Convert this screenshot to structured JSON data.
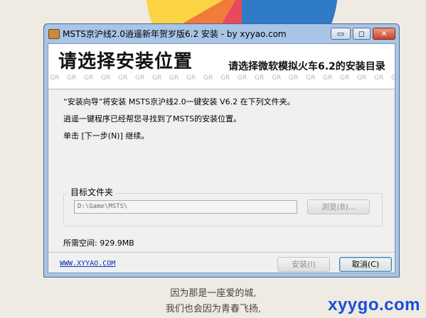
{
  "window": {
    "title": "MSTS京沪线2.0逍遥新年贺岁版6.2 安装 - by xyyao.com",
    "minimize_label": "▭",
    "maximize_label": "◻",
    "close_label": "✕"
  },
  "banner": {
    "heading": "请选择安装位置",
    "subheading": "请选择微软模拟火车6.2的安装目录",
    "watermark": "GR"
  },
  "body": {
    "line1": "“安装向导”将安装 MSTS京沪线2.0一键安装 V6.2 在下列文件夹。",
    "line2": "逍遥一键程序已经帮您寻找到了MSTS的安装位置。",
    "line3": "单击 [下一步(N)] 继续。",
    "group_label": "目标文件夹",
    "path_value": "D:\\Game\\MSTS\\",
    "browse_label": "浏览(B)...",
    "space_required": "所需空间: 929.9MB"
  },
  "footer": {
    "link": "WWW.XYYAO.COM",
    "install_label": "安装(I)",
    "cancel_label": "取消(C)"
  },
  "background": {
    "text1": "因为那是一座爱的城,",
    "text2": "我们也会因为青春飞扬,",
    "watermark_url": "xyygo.com"
  },
  "colors": {
    "window_frame": "#a8c4e6",
    "link": "#0a2fb8",
    "watermark_url": "#1a4fd8"
  },
  "icons": [
    "app-package-icon"
  ]
}
